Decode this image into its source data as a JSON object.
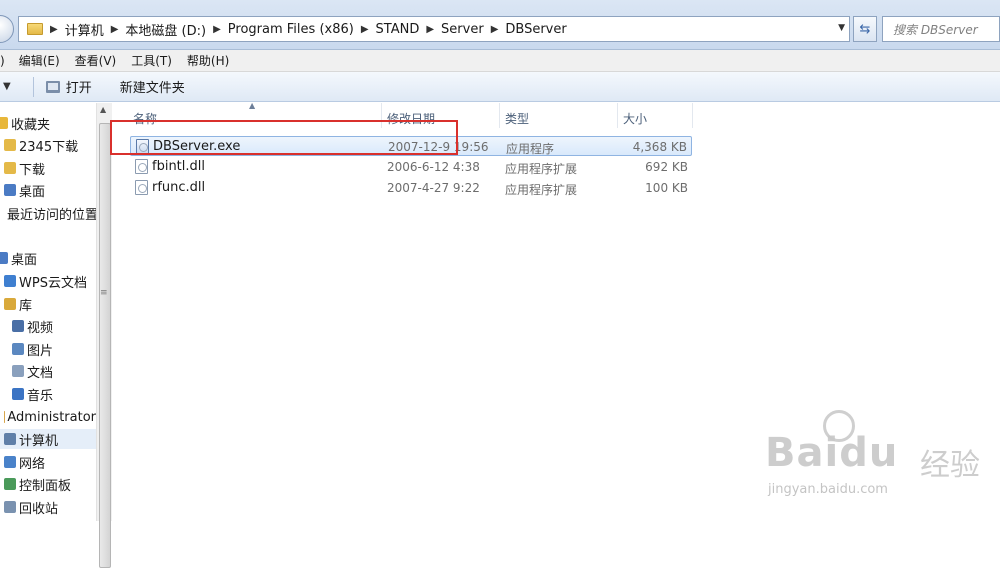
{
  "address": {
    "breadcrumbs": [
      "计算机",
      "本地磁盘 (D:)",
      "Program Files (x86)",
      "STAND",
      "Server",
      "DBServer"
    ],
    "search_placeholder": "搜索 DBServer"
  },
  "menu": [
    "编辑(E)",
    "查看(V)",
    "工具(T)",
    "帮助(H)"
  ],
  "menu_leading": ")",
  "toolbar": {
    "open_label": "打开",
    "new_folder_label": "新建文件夹"
  },
  "nav": {
    "items": [
      {
        "label": "收藏夹",
        "icon": "star-icon",
        "color": "#e8b73a"
      },
      {
        "label": "2345下载",
        "icon": "folder-icon",
        "color": "#e4b948"
      },
      {
        "label": "下载",
        "icon": "download-folder-icon",
        "color": "#e4b948"
      },
      {
        "label": "桌面",
        "icon": "desktop-icon",
        "color": "#4b7bc4"
      },
      {
        "label": "最近访问的位置",
        "icon": "recent-places-icon",
        "color": "#6a8fc8"
      },
      {
        "label": "桌面",
        "icon": "desktop-icon",
        "color": "#4b7bc4"
      },
      {
        "label": "WPS云文档",
        "icon": "cloud-icon",
        "color": "#3f7fd0"
      },
      {
        "label": "库",
        "icon": "library-icon",
        "color": "#d9a93b"
      },
      {
        "label": "视频",
        "icon": "video-icon",
        "color": "#4a6fa6"
      },
      {
        "label": "图片",
        "icon": "pictures-icon",
        "color": "#5b88c0"
      },
      {
        "label": "文档",
        "icon": "documents-icon",
        "color": "#8aa0bd"
      },
      {
        "label": "音乐",
        "icon": "music-icon",
        "color": "#3b74c4"
      },
      {
        "label": "Administrator",
        "icon": "user-icon",
        "color": "#d8a64b"
      },
      {
        "label": "计算机",
        "icon": "computer-icon",
        "color": "#5f7fa8"
      },
      {
        "label": "网络",
        "icon": "network-icon",
        "color": "#4a82c9"
      },
      {
        "label": "控制面板",
        "icon": "control-panel-icon",
        "color": "#4a9a5a"
      },
      {
        "label": "回收站",
        "icon": "recycle-bin-icon",
        "color": "#7a92b0"
      }
    ],
    "selected_index": 13
  },
  "columns": {
    "name": "名称",
    "date": "修改日期",
    "type": "类型",
    "size": "大小"
  },
  "files": [
    {
      "name": "DBServer.exe",
      "date": "2007-12-9 19:56",
      "type": "应用程序",
      "size": "4,368 KB",
      "icon": "exe-icon"
    },
    {
      "name": "fbintl.dll",
      "date": "2006-6-12 4:38",
      "type": "应用程序扩展",
      "size": "692 KB",
      "icon": "dll-icon"
    },
    {
      "name": "rfunc.dll",
      "date": "2007-4-27 9:22",
      "type": "应用程序扩展",
      "size": "100 KB",
      "icon": "dll-icon"
    }
  ],
  "selected_file_index": 0,
  "watermark": {
    "brand": "Bai",
    "brand2": "du",
    "suffix": "经验",
    "url": "jingyan.baidu.com"
  },
  "colors": {
    "highlight": "#d9302c",
    "selection": "#d9e9fb"
  }
}
